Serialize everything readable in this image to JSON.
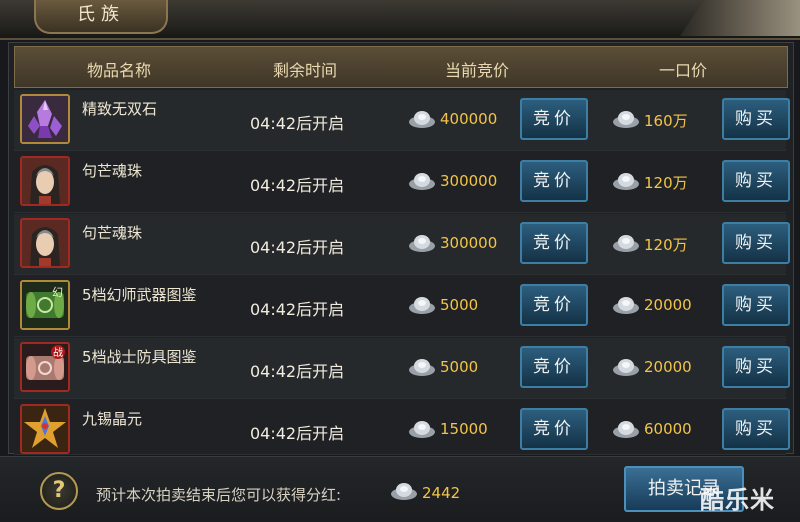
{
  "tab_label": "氏族",
  "header": {
    "col_name": "物品名称",
    "col_time": "剩余时间",
    "col_bid": "当前竞价",
    "col_buyout": "一口价"
  },
  "rows": [
    {
      "name": "精致无双石",
      "time": "04:42后开启",
      "bid": "400000",
      "bid_button": "竞价",
      "buyout": "160万",
      "buy_button": "购买",
      "icon": "purple-crystal-icon"
    },
    {
      "name": "句芒魂珠",
      "time": "04:42后开启",
      "bid": "300000",
      "bid_button": "竞价",
      "buyout": "120万",
      "buy_button": "购买",
      "icon": "hero-portrait-icon"
    },
    {
      "name": "句芒魂珠",
      "time": "04:42后开启",
      "bid": "300000",
      "bid_button": "竞价",
      "buyout": "120万",
      "buy_button": "购买",
      "icon": "hero-portrait-icon"
    },
    {
      "name": "5档幻师武器图鉴",
      "time": "04:42后开启",
      "bid": "5000",
      "bid_button": "竞价",
      "buyout": "20000",
      "buy_button": "购买",
      "icon": "green-scroll-icon",
      "icon_glyph": "幻"
    },
    {
      "name": "5档战士防具图鉴",
      "time": "04:42后开启",
      "bid": "5000",
      "bid_button": "竞价",
      "buyout": "20000",
      "buy_button": "购买",
      "icon": "red-scroll-icon",
      "icon_glyph": "战"
    },
    {
      "name": "九锡晶元",
      "time": "04:42后开启",
      "bid": "15000",
      "bid_button": "竞价",
      "buyout": "60000",
      "buy_button": "购买",
      "icon": "gold-star-gem-icon"
    }
  ],
  "footer": {
    "help": "?",
    "text": "预计本次拍卖结束后您可以获得分红:",
    "amount": "2442",
    "record_button": "拍卖记录"
  },
  "watermark": "酷乐米"
}
